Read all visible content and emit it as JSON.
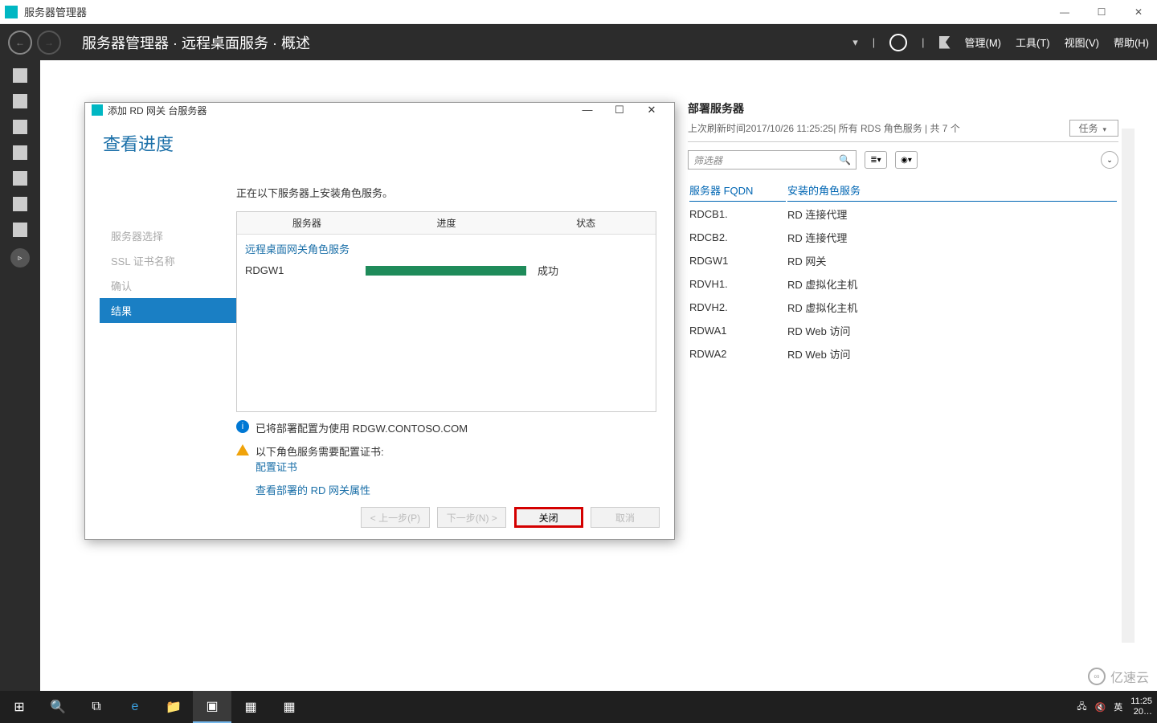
{
  "window": {
    "app_title": "服务器管理器",
    "min": "—",
    "max": "☐",
    "close": "✕"
  },
  "topbar": {
    "breadcrumb": "服务器管理器 · 远程桌面服务 · 概述",
    "menus": {
      "manage": "管理(M)",
      "tools": "工具(T)",
      "view": "视图(V)",
      "help": "帮助(H)"
    }
  },
  "deployment": {
    "title": "部署服务器",
    "meta_prefix": "上次刷新时间 ",
    "meta_time": "2017/10/26 11:25:25",
    "meta_suffix": " | 所有 RDS 角色服务  | 共 7 个",
    "tasks_btn": "任务",
    "filter_placeholder": "筛选器",
    "col_server": "服务器 FQDN",
    "col_role": "安装的角色服务",
    "rows": [
      {
        "fqdn": "RDCB1.",
        "role": "RD 连接代理"
      },
      {
        "fqdn": "RDCB2.",
        "role": "RD 连接代理"
      },
      {
        "fqdn": "RDGW1",
        "role": "RD 网关"
      },
      {
        "fqdn": "RDVH1.",
        "role": "RD 虚拟化主机"
      },
      {
        "fqdn": "RDVH2.",
        "role": "RD 虚拟化主机"
      },
      {
        "fqdn": "RDWA1",
        "role": "RD Web 访问"
      },
      {
        "fqdn": "RDWA2",
        "role": "RD Web 访问"
      }
    ]
  },
  "modal": {
    "title": "添加 RD 网关 台服务器",
    "heading": "查看进度",
    "nav": {
      "n1": "服务器选择",
      "n2": "SSL 证书名称",
      "n3": "确认",
      "n4": "结果"
    },
    "intro": "正在以下服务器上安装角色服务。",
    "hdr_server": "服务器",
    "hdr_progress": "进度",
    "hdr_status": "状态",
    "service_name": "远程桌面网关角色服务",
    "row_server": "RDGW1",
    "row_status": "成功",
    "info_text": "已将部署配置为使用 RDGW.CONTOSO.COM",
    "warn_text": "以下角色服务需要配置证书:",
    "warn_link": "配置证书",
    "view_link": "查看部署的 RD 网关属性",
    "btn_prev": "< 上一步(P)",
    "btn_next": "下一步(N) >",
    "btn_close": "关闭",
    "btn_cancel": "取消"
  },
  "taskbar": {
    "ime": "英",
    "clock_time": "11:25",
    "clock_date": "20…"
  },
  "watermark": "亿速云"
}
